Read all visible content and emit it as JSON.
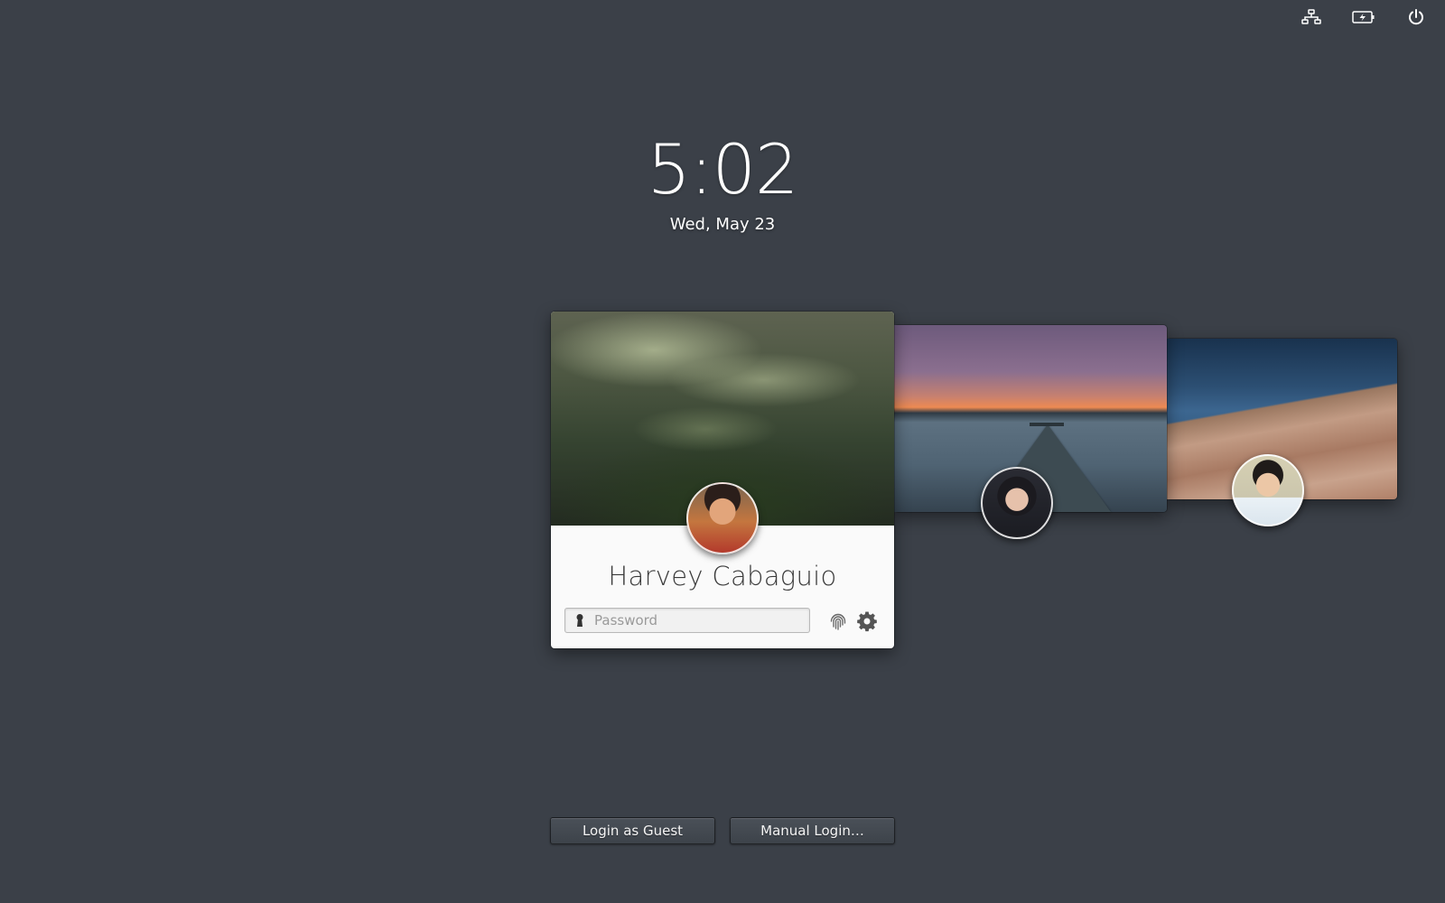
{
  "indicators": [
    {
      "icon": "network-wired-icon"
    },
    {
      "icon": "battery-charging-icon"
    },
    {
      "icon": "power-icon"
    }
  ],
  "clock": {
    "time": "5:02",
    "date": "Wed, May 23"
  },
  "users": [
    {
      "name": "Harvey Cabaguio",
      "background": "misty forest",
      "avatar": "user-avatar-harvey"
    },
    {
      "name": "",
      "background": "pier at sunset",
      "avatar": "user-avatar-2"
    },
    {
      "name": "",
      "background": "dock and water",
      "avatar": "user-avatar-3"
    }
  ],
  "login": {
    "password_placeholder": "Password",
    "password_value": ""
  },
  "buttons": {
    "guest_label": "Login as Guest",
    "manual_label": "Manual Login…"
  },
  "colors": {
    "background": "#3b4048",
    "card": "#fafafa",
    "text_on_card": "#3a3a3a",
    "clock_text": "#ffffff"
  }
}
